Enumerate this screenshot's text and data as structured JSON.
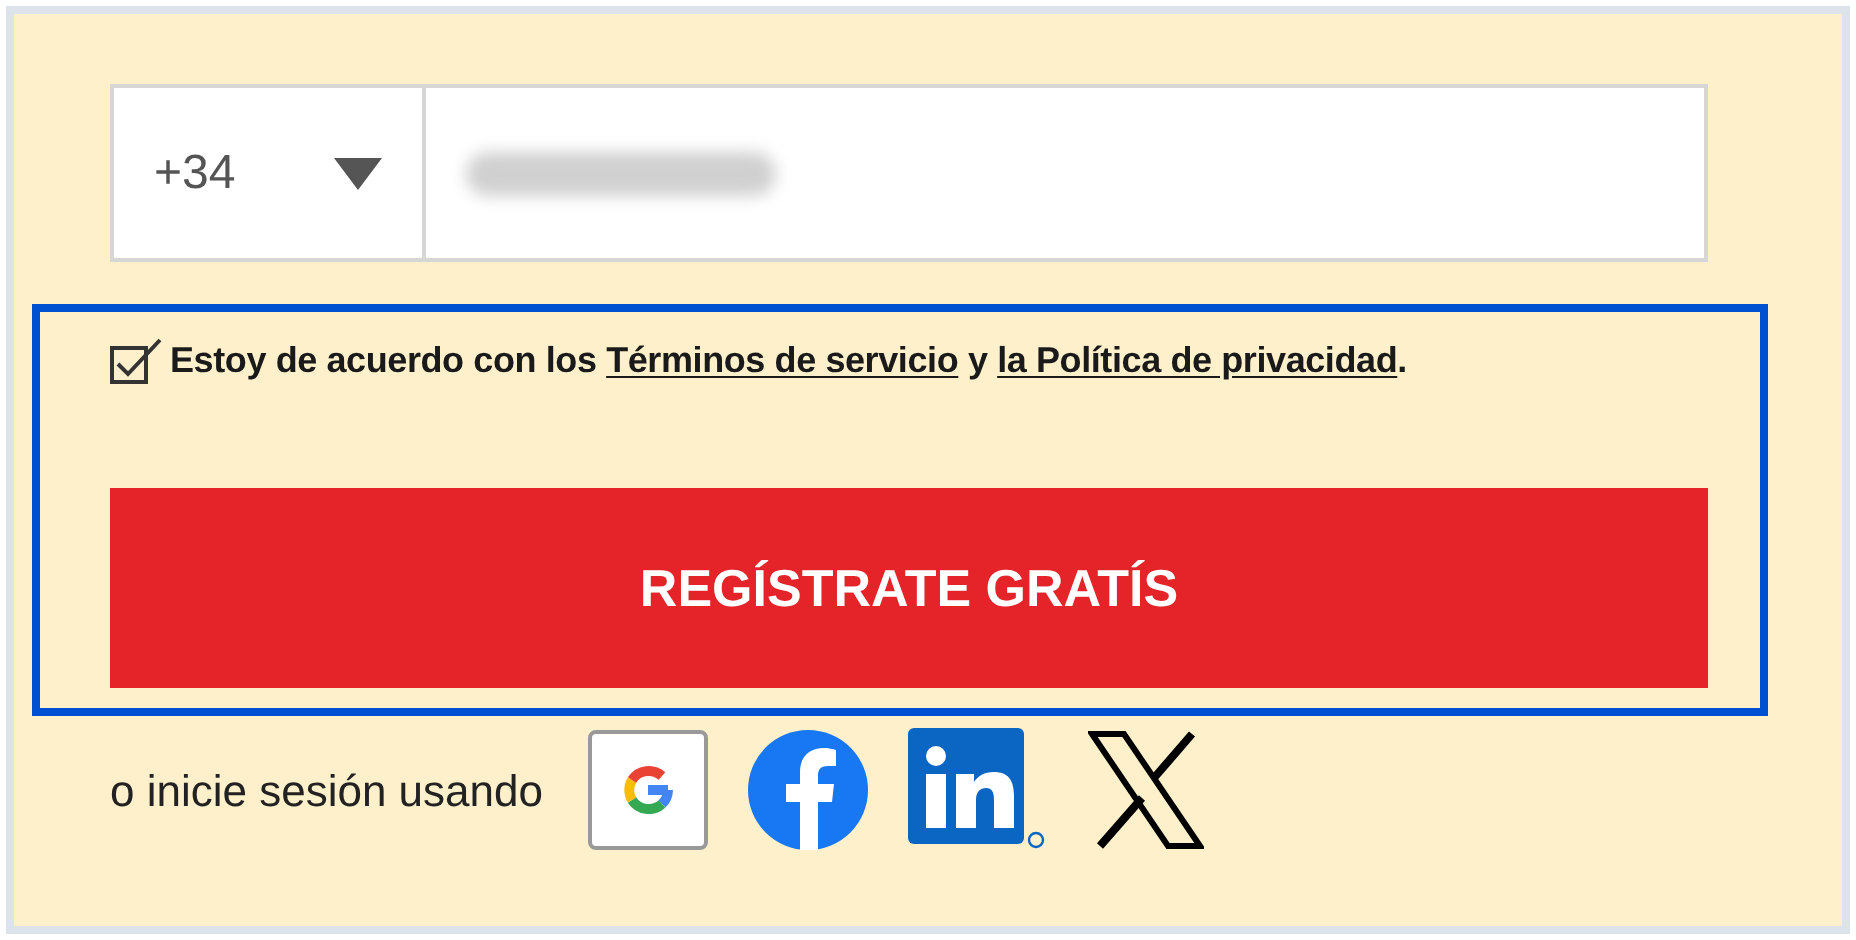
{
  "phone": {
    "country_code": "+34"
  },
  "consent": {
    "checked": true,
    "parts": [
      {
        "kind": "text",
        "text": "Estoy de acuerdo con los "
      },
      {
        "kind": "link",
        "text": "Términos de servicio"
      },
      {
        "kind": "text",
        "text": " y "
      },
      {
        "kind": "link",
        "text": "la Política de privacidad"
      },
      {
        "kind": "text",
        "text": "."
      }
    ]
  },
  "submit_button": "REGÍSTRATE GRATÍS",
  "social_login": {
    "label": "o inicie sesión usando",
    "providers": [
      {
        "kind": "google"
      },
      {
        "kind": "facebook"
      },
      {
        "kind": "linkedin"
      },
      {
        "kind": "x"
      }
    ]
  }
}
